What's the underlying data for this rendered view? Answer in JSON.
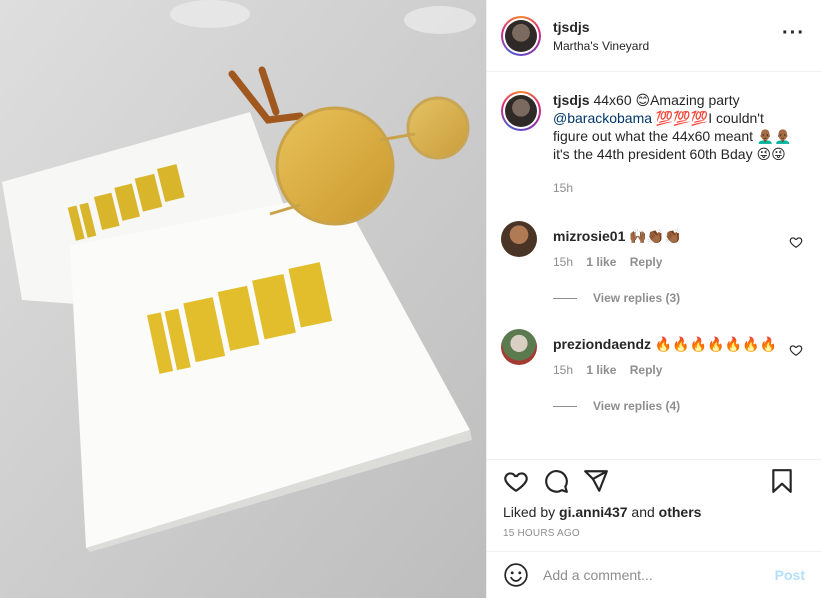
{
  "post": {
    "username": "tjsdjs",
    "location": "Martha's Vineyard",
    "more_icon": "more-horizontal-icon",
    "image_text": "44x60"
  },
  "caption": {
    "username": "tjsdjs",
    "text_1": "44x60 😊Amazing party",
    "mention": "@barackobama",
    "text_2": " 💯💯💯I couldn't figure out what the 44x60 meant 👨🏾‍🦲👨🏾‍🦲it's the 44th president 60th Bday 😜😜",
    "time": "15h"
  },
  "comments": [
    {
      "username": "mizrosie01",
      "text": "🙌🏾👏🏾👏🏾",
      "time": "15h",
      "likes": "1 like",
      "reply": "Reply",
      "view_replies": "View replies (3)",
      "avatar_color": "#7d5a44"
    },
    {
      "username": "preziondaendz",
      "text": "🔥🔥🔥🔥🔥🔥🔥",
      "time": "15h",
      "likes": "1 like",
      "reply": "Reply",
      "view_replies": "View replies (4)",
      "avatar_color": "#5c7a4f"
    }
  ],
  "actions": {
    "liked_prefix": "Liked by",
    "liked_user": "gi.anni437",
    "liked_and": "and",
    "liked_others": "others",
    "timestamp": "15 HOURS AGO",
    "icons": [
      "heart-icon",
      "comment-icon",
      "share-icon",
      "bookmark-icon"
    ]
  },
  "add_comment": {
    "placeholder": "Add a comment...",
    "post_label": "Post",
    "post_color": "#b2dffc"
  }
}
